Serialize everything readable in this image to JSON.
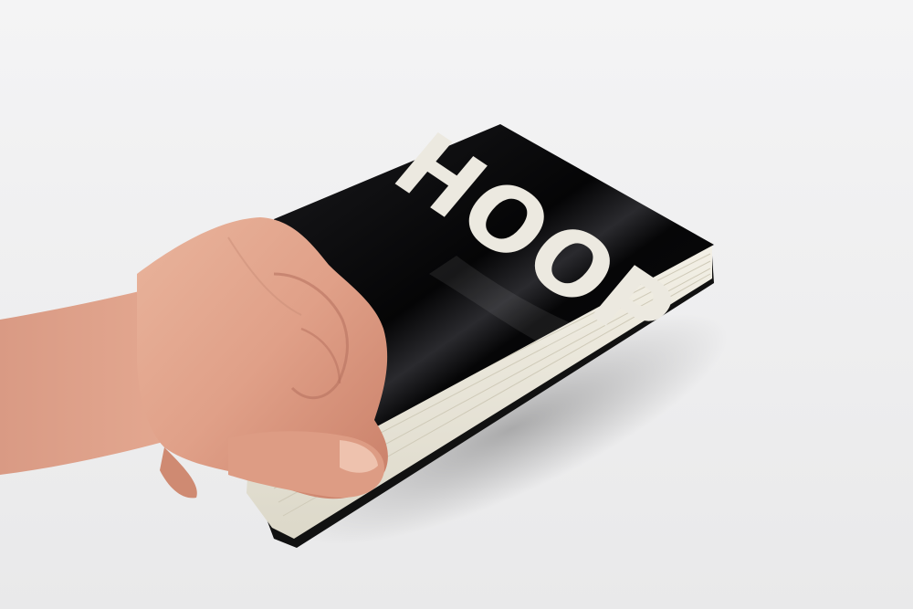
{
  "photo": {
    "background_color": "#f1f1f2",
    "book": {
      "cover_title": "HOOP",
      "cover_color": "#0b0b0d",
      "title_color": "#ece9e0",
      "page_color": "#ece9dc"
    },
    "skin_color": "#e2a38a"
  }
}
